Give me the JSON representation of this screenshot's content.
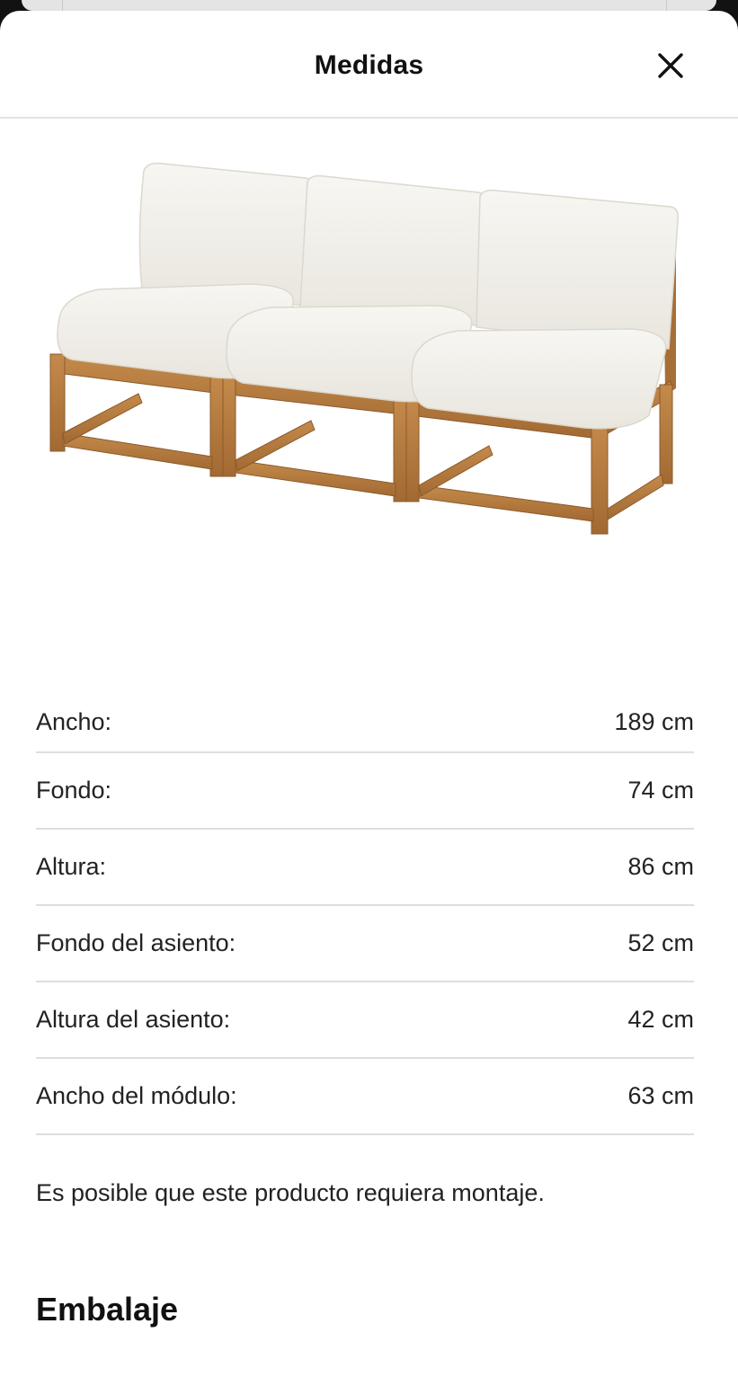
{
  "header": {
    "title": "Medidas",
    "close_icon": "close-icon"
  },
  "product_image": {
    "description_icon": "sofa-image",
    "colors": {
      "cushion": "#f1efe9",
      "wood": "#b37a3e"
    }
  },
  "dimensions": [
    {
      "label": "Ancho:",
      "value": "189 cm"
    },
    {
      "label": "Fondo:",
      "value": "74 cm"
    },
    {
      "label": "Altura:",
      "value": "86 cm"
    },
    {
      "label": "Fondo del asiento:",
      "value": "52 cm"
    },
    {
      "label": "Altura del asiento:",
      "value": "42 cm"
    },
    {
      "label": "Ancho del módulo:",
      "value": "63 cm"
    }
  ],
  "assembly_note": "Es posible que este producto requiera montaje.",
  "packaging": {
    "title": "Embalaje"
  }
}
